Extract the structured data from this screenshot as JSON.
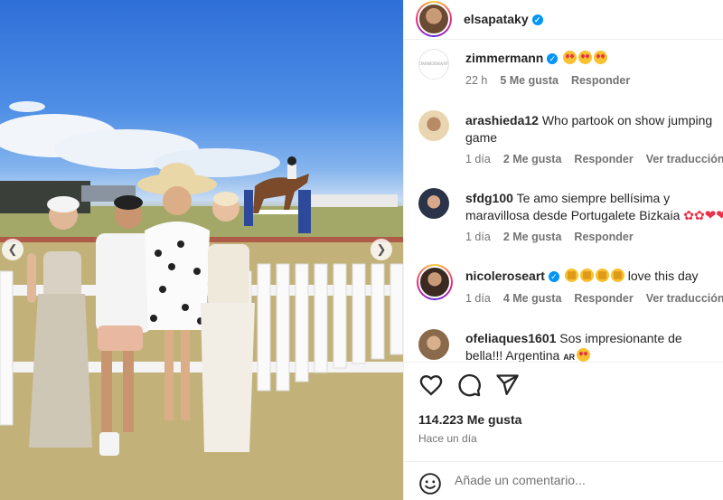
{
  "post": {
    "author": "elsapataky",
    "author_verified": true
  },
  "comments": [
    {
      "username": "zimmermann",
      "verified": true,
      "text": "",
      "emojis": [
        "heart-eyes",
        "heart-eyes",
        "heart-eyes"
      ],
      "meta": {
        "time": "22 h",
        "likes": "5 Me gusta",
        "reply": "Responder",
        "translate": ""
      }
    },
    {
      "username": "arashieda12",
      "verified": false,
      "text": "Who partook on show jumping game",
      "meta": {
        "time": "1 día",
        "likes": "2 Me gusta",
        "reply": "Responder",
        "translate": "Ver traducción"
      }
    },
    {
      "username": "sfdg100",
      "verified": false,
      "text": "Te amo siempre bellísima y maravillosa desde Portugalete Bizkaia",
      "meta": {
        "time": "1 día",
        "likes": "2 Me gusta",
        "reply": "Responder",
        "translate": ""
      }
    },
    {
      "username": "nicoleroseart",
      "verified": true,
      "text": "love this day",
      "meta": {
        "time": "1 día",
        "likes": "4 Me gusta",
        "reply": "Responder",
        "translate": "Ver traducción"
      }
    },
    {
      "username": "ofeliaques1601",
      "verified": false,
      "text": "Sos impresionante de bella!!! Argentina",
      "flag": "AR"
    }
  ],
  "stats": {
    "likes": "114.223 Me gusta",
    "posted": "Hace un día"
  },
  "add_comment": {
    "placeholder": "Añade un comentario..."
  },
  "icons": {
    "like": "heart-icon",
    "comment": "comment-icon",
    "share": "paper-plane-icon",
    "emoji": "smile-icon",
    "prev": "chevron-left-icon",
    "next": "chevron-right-icon"
  },
  "colors": {
    "verified": "#0095f6",
    "text": "#262626",
    "secondary": "#737373"
  }
}
